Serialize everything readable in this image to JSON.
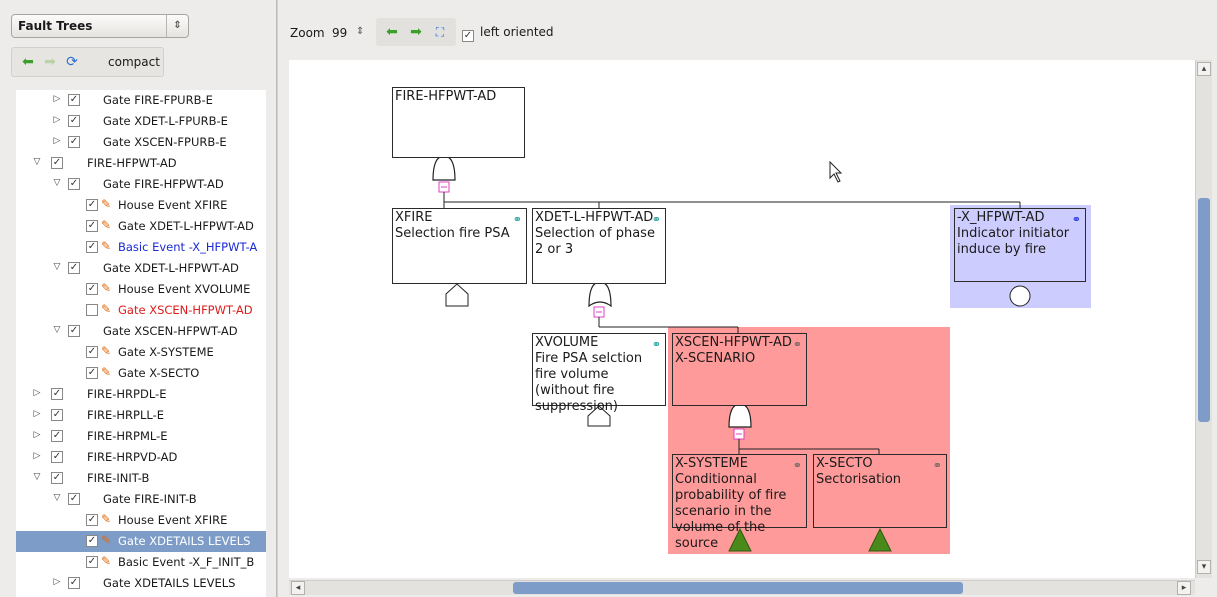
{
  "left_panel": {
    "view_select": "Fault Trees",
    "compact_label": "compact",
    "tree": [
      {
        "label": "Gate FIRE-FPURB-E",
        "style": "normal"
      },
      {
        "label": "Gate XDET-L-FPURB-E",
        "style": "normal"
      },
      {
        "label": "Gate XSCEN-FPURB-E",
        "style": "normal"
      },
      {
        "label": "FIRE-HFPWT-AD",
        "style": "normal"
      },
      {
        "label": "Gate FIRE-HFPWT-AD",
        "style": "normal"
      },
      {
        "label": "House Event  XFIRE",
        "style": "normal"
      },
      {
        "label": "Gate  XDET-L-HFPWT-AD",
        "style": "normal"
      },
      {
        "label": "Basic Event  -X_HFPWT-A",
        "style": "blue"
      },
      {
        "label": "Gate XDET-L-HFPWT-AD",
        "style": "normal"
      },
      {
        "label": "House Event  XVOLUME",
        "style": "normal"
      },
      {
        "label": "Gate  XSCEN-HFPWT-AD",
        "style": "red"
      },
      {
        "label": "Gate XSCEN-HFPWT-AD",
        "style": "normal"
      },
      {
        "label": "Gate  X-SYSTEME",
        "style": "normal"
      },
      {
        "label": "Gate  X-SECTO",
        "style": "normal"
      },
      {
        "label": "FIRE-HRPDL-E",
        "style": "normal"
      },
      {
        "label": "FIRE-HRPLL-E",
        "style": "normal"
      },
      {
        "label": "FIRE-HRPML-E",
        "style": "normal"
      },
      {
        "label": "FIRE-HRPVD-AD",
        "style": "normal"
      },
      {
        "label": "FIRE-INIT-B",
        "style": "normal"
      },
      {
        "label": "Gate FIRE-INIT-B",
        "style": "normal"
      },
      {
        "label": "House Event  XFIRE",
        "style": "normal"
      },
      {
        "label": "Gate  XDETAILS LEVELS",
        "style": "selected"
      },
      {
        "label": "Basic Event  -X_F_INIT_B",
        "style": "normal"
      },
      {
        "label": "Gate XDETAILS LEVELS",
        "style": "normal"
      }
    ]
  },
  "toolbar": {
    "zoom_label": "Zoom",
    "zoom_value": "99",
    "left_oriented_label": "left oriented"
  },
  "diagram": {
    "root": {
      "name": "FIRE-HFPWT-AD"
    },
    "xfire": {
      "name": "XFIRE",
      "desc": "Selection fire PSA"
    },
    "xdet": {
      "name": "XDET-L-HFPWT-A",
      "name_overlap": "D",
      "desc": "election of phase",
      "desc_overlap": "S",
      "desc2": "2 or 3"
    },
    "xhfpwt": {
      "name": "-X_HFPWT-AD",
      "desc": "Indicator initiator induce by fire"
    },
    "xvolume": {
      "name": "XVOLUME",
      "desc": "Fire PSA selction fire volume (without fire suppression)"
    },
    "xscen": {
      "name": "XSCEN-HFPWT-A",
      "name_overlap": "D",
      "desc": "-SCENARIO",
      "desc_overlap": "X"
    },
    "xsysteme": {
      "name": "X-SYSTEME",
      "desc": "Conditionnal probability of fire scenario in the volume of the source"
    },
    "xsecto": {
      "name": "X-SECTO",
      "desc": "Sectorisation"
    }
  },
  "colors": {
    "selection_blue": "#7d9dc8",
    "red_highlight": "#ff9a9a",
    "blue_highlight": "#ccccff",
    "triangle_green": "#4a8a1a"
  }
}
